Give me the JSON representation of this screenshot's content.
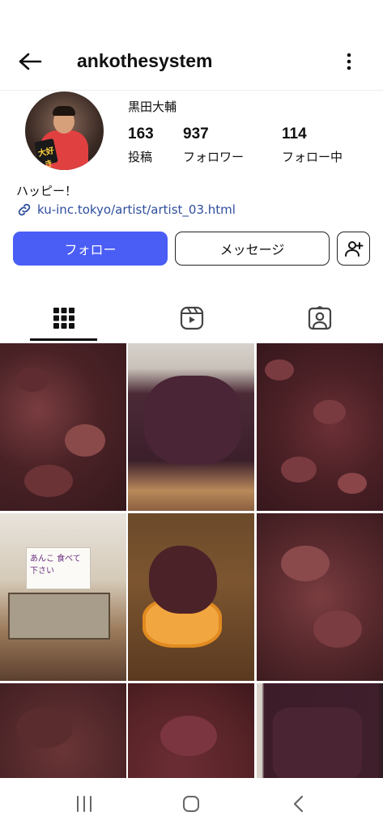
{
  "header": {
    "username": "ankothesystem",
    "back_icon": "back-arrow-icon",
    "more_icon": "more-vertical-icon"
  },
  "profile": {
    "display_name": "黒田大輔",
    "stats": {
      "posts": {
        "value": "163",
        "label": "投稿"
      },
      "followers": {
        "value": "937",
        "label": "フォロワー"
      },
      "following": {
        "value": "114",
        "label": "フォロー中"
      }
    },
    "bio": "ハッピー！",
    "link": "ku-inc.tokyo/artist/artist_03.html",
    "avatar_sign_text": "大好き"
  },
  "actions": {
    "follow_label": "フォロー",
    "message_label": "メッセージ",
    "add_user_icon": "add-person-icon"
  },
  "tabs": [
    {
      "name": "grid",
      "icon": "grid-icon",
      "active": true
    },
    {
      "name": "reels",
      "icon": "reels-icon",
      "active": false
    },
    {
      "name": "tagged",
      "icon": "tagged-person-icon",
      "active": false
    }
  ],
  "grid_posts": [
    {
      "subject": "azuki bean paste closeup"
    },
    {
      "subject": "anko on bread"
    },
    {
      "subject": "azuki beans closeup"
    },
    {
      "subject": "sweets stall with sign"
    },
    {
      "subject": "anko on cracker"
    },
    {
      "subject": "anko paste texture"
    },
    {
      "subject": "anko paste texture"
    },
    {
      "subject": "anko paste texture"
    },
    {
      "subject": "anko in tray"
    }
  ],
  "post_sign_text": "あんこ 食べて下さい",
  "system_nav": {
    "recent_icon": "recent-apps-icon",
    "home_icon": "home-icon",
    "back_icon": "system-back-icon"
  },
  "colors": {
    "follow_button": "#4a5df5",
    "link": "#2e4e9c",
    "text": "#111111"
  }
}
